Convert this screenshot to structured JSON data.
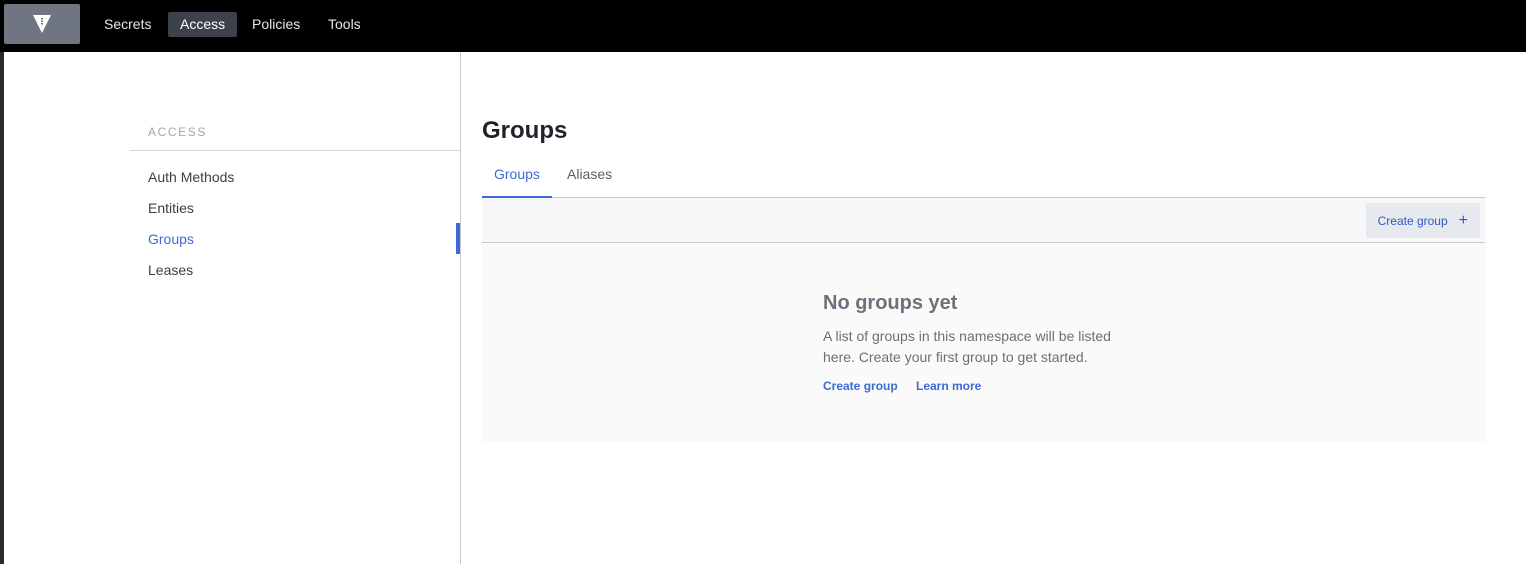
{
  "topnav": {
    "logo_icon": "vault-logo-icon",
    "items": [
      {
        "label": "Secrets"
      },
      {
        "label": "Access",
        "active": true
      },
      {
        "label": "Policies"
      },
      {
        "label": "Tools"
      }
    ]
  },
  "sidebar": {
    "heading": "ACCESS",
    "items": [
      {
        "label": "Auth Methods"
      },
      {
        "label": "Entities"
      },
      {
        "label": "Groups",
        "active": true
      },
      {
        "label": "Leases"
      }
    ]
  },
  "main": {
    "title": "Groups",
    "tabs": [
      {
        "label": "Groups",
        "active": true
      },
      {
        "label": "Aliases"
      }
    ],
    "toolbar": {
      "create_label": "Create group",
      "create_icon": "plus-icon"
    },
    "empty_state": {
      "title": "No groups yet",
      "description": "A list of groups in this namespace will be listed here. Create your first group to get started.",
      "links": [
        {
          "label": "Create group"
        },
        {
          "label": "Learn more"
        }
      ]
    }
  },
  "colors": {
    "accent": "#3c6ad6",
    "topbar": "#000000",
    "active_nav": "#3d4149"
  }
}
